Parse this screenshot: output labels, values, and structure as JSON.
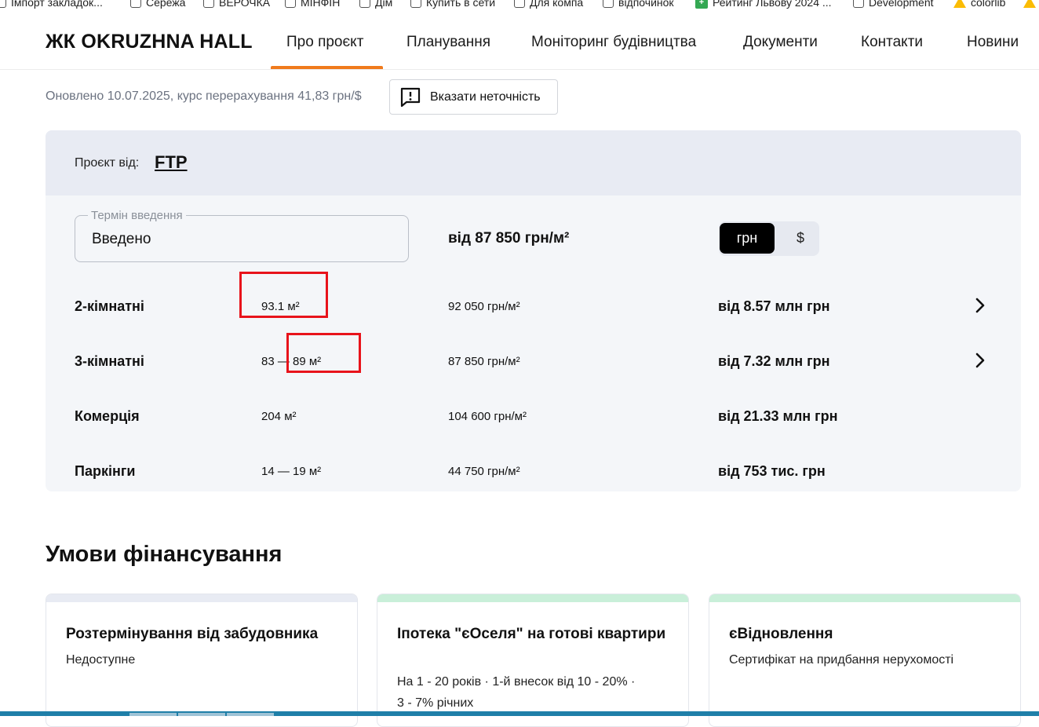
{
  "bookmarks": [
    {
      "label": "Імпорт закладок..."
    },
    {
      "label": "Сережа"
    },
    {
      "label": "ВЕРОЧКА"
    },
    {
      "label": "МІНФІН"
    },
    {
      "label": "Дім"
    },
    {
      "label": "Купить в сети"
    },
    {
      "label": "Для компа"
    },
    {
      "label": "відпочинок"
    },
    {
      "label": "Рейтинг Львову 2024 ..."
    },
    {
      "label": "Development"
    },
    {
      "label": "colorlib"
    }
  ],
  "header": {
    "logo": "ЖК OKRUZHNA HALL",
    "nav": [
      "Про проєкт",
      "Планування",
      "Моніторинг будівництва",
      "Документи",
      "Контакти",
      "Новини"
    ],
    "active_tab": "Про проєкт",
    "accent_color": "#f07a1c"
  },
  "info": {
    "updated": "Оновлено 10.07.2025, курс перерахування 41,83 грн/$",
    "report_button": "Вказати неточність",
    "report_icon": "message-alert-icon"
  },
  "project": {
    "developer_label": "Проєкт від:",
    "developer_name": "FTP",
    "term_legend": "Термін введення",
    "term_value": "Введено",
    "price_from": "від 87 850 грн/м²",
    "currency_options": [
      "грн",
      "$"
    ],
    "currency_selected": "грн",
    "rows": [
      {
        "type": "2-кімнатні",
        "area": "93.1 м²",
        "price_per_m2": "92 050 грн/м²",
        "total": "від 8.57 млн грн",
        "has_arrow": true
      },
      {
        "type": "3-кімнатні",
        "area": "83 — 89 м²",
        "price_per_m2": "87 850 грн/м²",
        "total": "від 7.32 млн грн",
        "has_arrow": true
      },
      {
        "type": "Комерція",
        "area": "204 м²",
        "price_per_m2": "104 600 грн/м²",
        "total": "від 21.33 млн грн",
        "has_arrow": false
      },
      {
        "type": "Паркінги",
        "area": "14 — 19 м²",
        "price_per_m2": "44 750 грн/м²",
        "total": "від 753 тис. грн",
        "has_arrow": false
      }
    ]
  },
  "financing": {
    "title": "Умови фінансування",
    "cards": [
      {
        "title": "Розтермінування від забудовника",
        "desc": [
          "Недоступне"
        ],
        "strip_color": "#e8ebf3"
      },
      {
        "title": "Іпотека \"єОселя\" на готові квартири",
        "desc": [
          "На 1 - 20 років · 1-й внесок від 10 - 20% ·",
          "3 - 7% річних"
        ],
        "strip_color": "#c9efd9"
      },
      {
        "title": "єВідновлення",
        "desc": [
          "Сертифікат на придбання нерухомості"
        ],
        "strip_color": "#c9efd9"
      }
    ]
  },
  "annotation_color": "#e8131b"
}
